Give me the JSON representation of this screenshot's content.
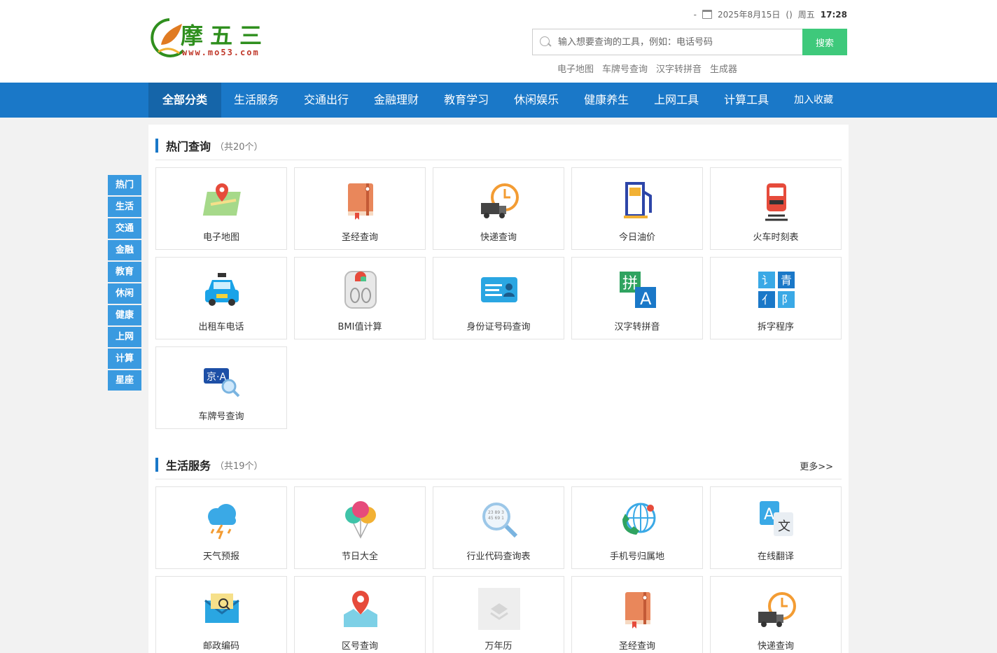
{
  "logo": {
    "brand": "摩五三",
    "domain": "www.mo53.com"
  },
  "dateline": {
    "dash": "-",
    "date": "2025年8月15日",
    "paren": "()",
    "weekday": "周五",
    "time": "17:28"
  },
  "search": {
    "placeholder": "输入想要查询的工具，例如：电话号码",
    "button": "搜索"
  },
  "hot_links": [
    "电子地图",
    "车牌号查询",
    "汉字转拼音",
    "生成器"
  ],
  "nav": [
    "全部分类",
    "生活服务",
    "交通出行",
    "金融理财",
    "教育学习",
    "休闲娱乐",
    "健康养生",
    "上网工具",
    "计算工具",
    "加入收藏"
  ],
  "side_nav": [
    "热门",
    "生活",
    "交通",
    "金融",
    "教育",
    "休闲",
    "健康",
    "上网",
    "计算",
    "星座"
  ],
  "sections": {
    "hot": {
      "title": "热门查询",
      "count": "（共20个）",
      "items": [
        "电子地图",
        "圣经查询",
        "快递查询",
        "今日油价",
        "火车时刻表",
        "出租车电话",
        "BMI值计算",
        "身份证号码查询",
        "汉字转拼音",
        "拆字程序",
        "车牌号查询"
      ]
    },
    "life": {
      "title": "生活服务",
      "count": "（共19个）",
      "more": "更多>>",
      "items": [
        "天气预报",
        "节日大全",
        "行业代码查询表",
        "手机号归属地",
        "在线翻译",
        "邮政编码",
        "区号查询",
        "万年历",
        "圣经查询",
        "快递查询"
      ]
    }
  },
  "icons": {
    "hot": [
      "map-icon",
      "bible-icon",
      "express-icon",
      "fuel-icon",
      "train-icon",
      "taxi-icon",
      "scale-icon",
      "id-card-icon",
      "pinyin-icon",
      "split-char-icon",
      "plate-icon"
    ],
    "life": [
      "weather-icon",
      "balloon-icon",
      "code-search-icon",
      "phone-globe-icon",
      "translate-icon",
      "mail-icon",
      "area-code-icon",
      "calendar-icon",
      "bible-icon",
      "express-icon"
    ]
  },
  "colors": {
    "nav": "#1a78c8",
    "nav_active": "#1565a9",
    "side": "#3a9ae0",
    "search_button": "#3ec97b"
  }
}
